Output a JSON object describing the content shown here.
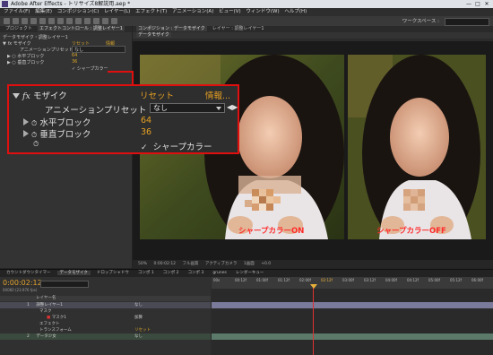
{
  "window": {
    "title": "Adobe After Effects - トリサイズ8解説用.aep *",
    "controls": [
      "—",
      "□",
      "✕"
    ]
  },
  "menu": [
    "ファイル(F)",
    "編集(E)",
    "コンポジション(C)",
    "レイヤー(L)",
    "エフェクト(T)",
    "アニメーション(A)",
    "ビュー(V)",
    "ウィンドウ(W)",
    "ヘルプ(H)"
  ],
  "toolbar": {
    "workspace": "ワークスペース :"
  },
  "left_panel": {
    "tabs": [
      "プロジェクト",
      "エフェクトコントロール : 調整レイヤー1"
    ],
    "breadcrumb": "データモザイク・調整レイヤー1",
    "effect_name": "モザイク",
    "reset": "リセット",
    "info": "情報",
    "preset_label": "アニメーションプリセット :",
    "preset_value": "なし",
    "h_label": "水平ブロック",
    "h_value": "64",
    "v_label": "垂直ブロック",
    "v_value": "36",
    "sharp_label": "シャープカラー"
  },
  "comp_panel": {
    "tabs": [
      "コンポジション : データモザイク",
      "レイヤー : 調整レイヤー1"
    ],
    "sub_tab": "データモザイク",
    "caption_left": "シャープカラーON",
    "caption_right": "シャープカラーOFF",
    "footer": [
      "50%",
      "0:00:02:12",
      "フル画質",
      "アクティブカメラ",
      "1画面",
      "+0.0"
    ]
  },
  "callout": {
    "fx": "fx",
    "effect_name": "モザイク",
    "reset": "リセット",
    "info": "情報...",
    "preset_label": "アニメーションプリセット :",
    "preset_value": "なし",
    "h_label": "水平ブロック",
    "h_value": "64",
    "v_label": "垂直ブロック",
    "v_value": "36",
    "sharp_label": "シャープカラー",
    "sharp_checked": true
  },
  "timeline": {
    "tabs": [
      "カウントダウンタイマー",
      "データモザイク",
      "ドロップシャドウ",
      "コンポ 1",
      "コンポ 2",
      "コンポ 3",
      "grunes",
      "レンダーキュー"
    ],
    "timecode": "0:00:02:12",
    "fps": "00060 (23.976 fps)",
    "col_header": "レイヤー名",
    "rows": [
      {
        "num": "1",
        "name": "調整レイヤー1",
        "mode": "なし"
      },
      {
        "num": "",
        "name": "マスク",
        "mode": ""
      },
      {
        "num": "",
        "name": "マスク1",
        "mode": "加算"
      },
      {
        "num": "",
        "name": "エフェクト",
        "mode": ""
      },
      {
        "num": "",
        "name": "トランスフォーム",
        "mode": "リセット"
      },
      {
        "num": "2",
        "name": "データ少女",
        "mode": "なし"
      }
    ],
    "ruler": [
      "00s",
      "00:12f",
      "01:00f",
      "01:12f",
      "02:00f",
      "02:12f",
      "03:00f",
      "03:12f",
      "04:00f",
      "04:12f",
      "05:00f",
      "05:12f",
      "06:00f"
    ]
  },
  "colors": {
    "accent": "#e6a123",
    "callout_border": "#e00f0f",
    "caption": "#ff2a2a"
  }
}
